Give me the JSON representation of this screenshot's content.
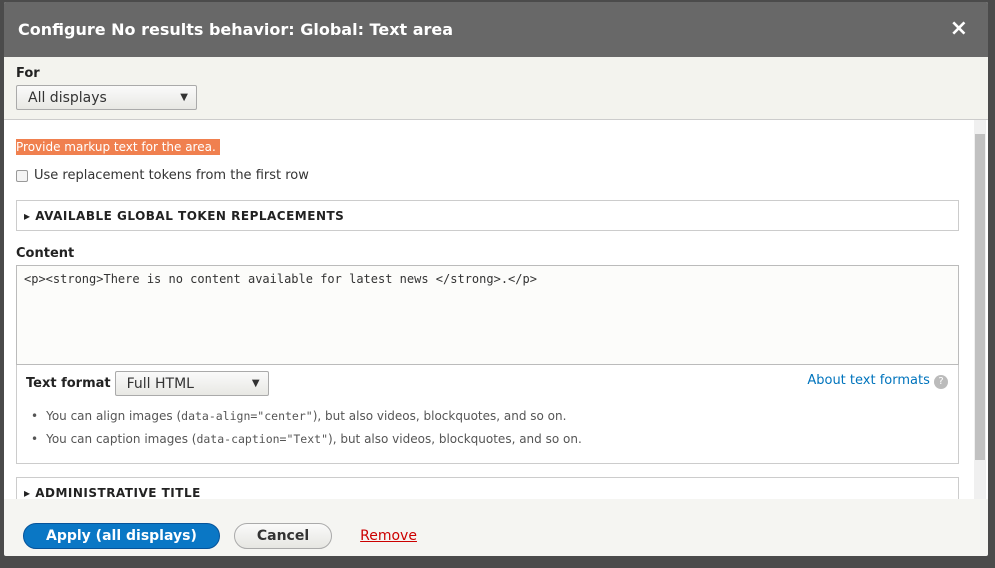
{
  "dialog": {
    "title": "Configure No results behavior: Global: Text area",
    "close": "×"
  },
  "for": {
    "label": "For",
    "value": "All displays"
  },
  "description": "Provide markup text for the area.",
  "tokens_checkbox": {
    "label": "Use replacement tokens from the first row",
    "checked": false
  },
  "global_tokens": "AVAILABLE GLOBAL TOKEN REPLACEMENTS",
  "content": {
    "label": "Content",
    "value": "<p><strong>There is no content available for latest news </strong>.</p>"
  },
  "text_format": {
    "label": "Text format",
    "value": "Full HTML",
    "about": "About text formats",
    "help": "?",
    "tips": [
      {
        "pre": "You can align images (",
        "code": "data-align=\"center\"",
        "post": "), but also videos, blockquotes, and so on."
      },
      {
        "pre": "You can caption images (",
        "code": "data-caption=\"Text\"",
        "post": "), but also videos, blockquotes, and so on."
      }
    ]
  },
  "admin_title": "ADMINISTRATIVE TITLE",
  "footer": {
    "apply": "Apply (all displays)",
    "cancel": "Cancel",
    "remove": "Remove"
  }
}
